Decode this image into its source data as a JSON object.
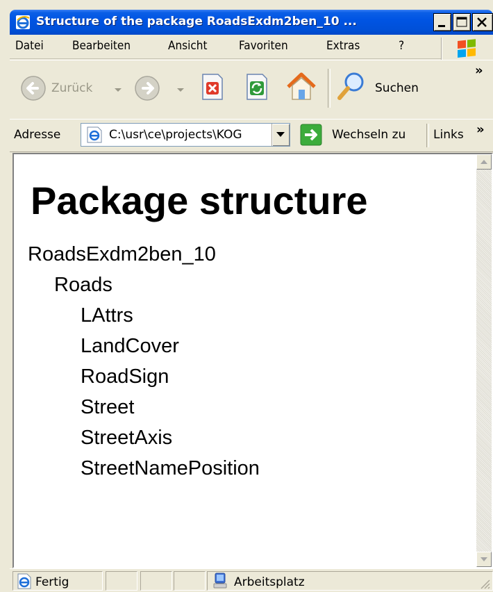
{
  "window": {
    "title": "Structure of the package RoadsExdm2ben_10 ..."
  },
  "menu": {
    "items": [
      {
        "label": "Datei"
      },
      {
        "label": "Bearbeiten"
      },
      {
        "label": "Ansicht"
      },
      {
        "label": "Favoriten"
      },
      {
        "label": "Extras"
      },
      {
        "label": "?"
      }
    ]
  },
  "toolbar": {
    "back_label": "Zurück",
    "search_label": "Suchen",
    "chevron": "»"
  },
  "address": {
    "label": "Adresse",
    "value": "C:\\usr\\ce\\projects\\KOG",
    "go_label": "Wechseln zu",
    "links_label": "Links",
    "chevron": "»"
  },
  "page": {
    "heading": "Package structure",
    "tree": [
      {
        "label": "RoadsExdm2ben_10",
        "level": 0
      },
      {
        "label": "Roads",
        "level": 1
      },
      {
        "label": "LAttrs",
        "level": 2
      },
      {
        "label": "LandCover",
        "level": 2
      },
      {
        "label": "RoadSign",
        "level": 2
      },
      {
        "label": "Street",
        "level": 2
      },
      {
        "label": "StreetAxis",
        "level": 2
      },
      {
        "label": "StreetNamePosition",
        "level": 2
      }
    ]
  },
  "status": {
    "text": "Fertig",
    "zone": "Arbeitsplatz"
  },
  "colors": {
    "titlebar": "#0054e3",
    "chrome": "#ece9d8",
    "go_green": "#3cac3c"
  }
}
